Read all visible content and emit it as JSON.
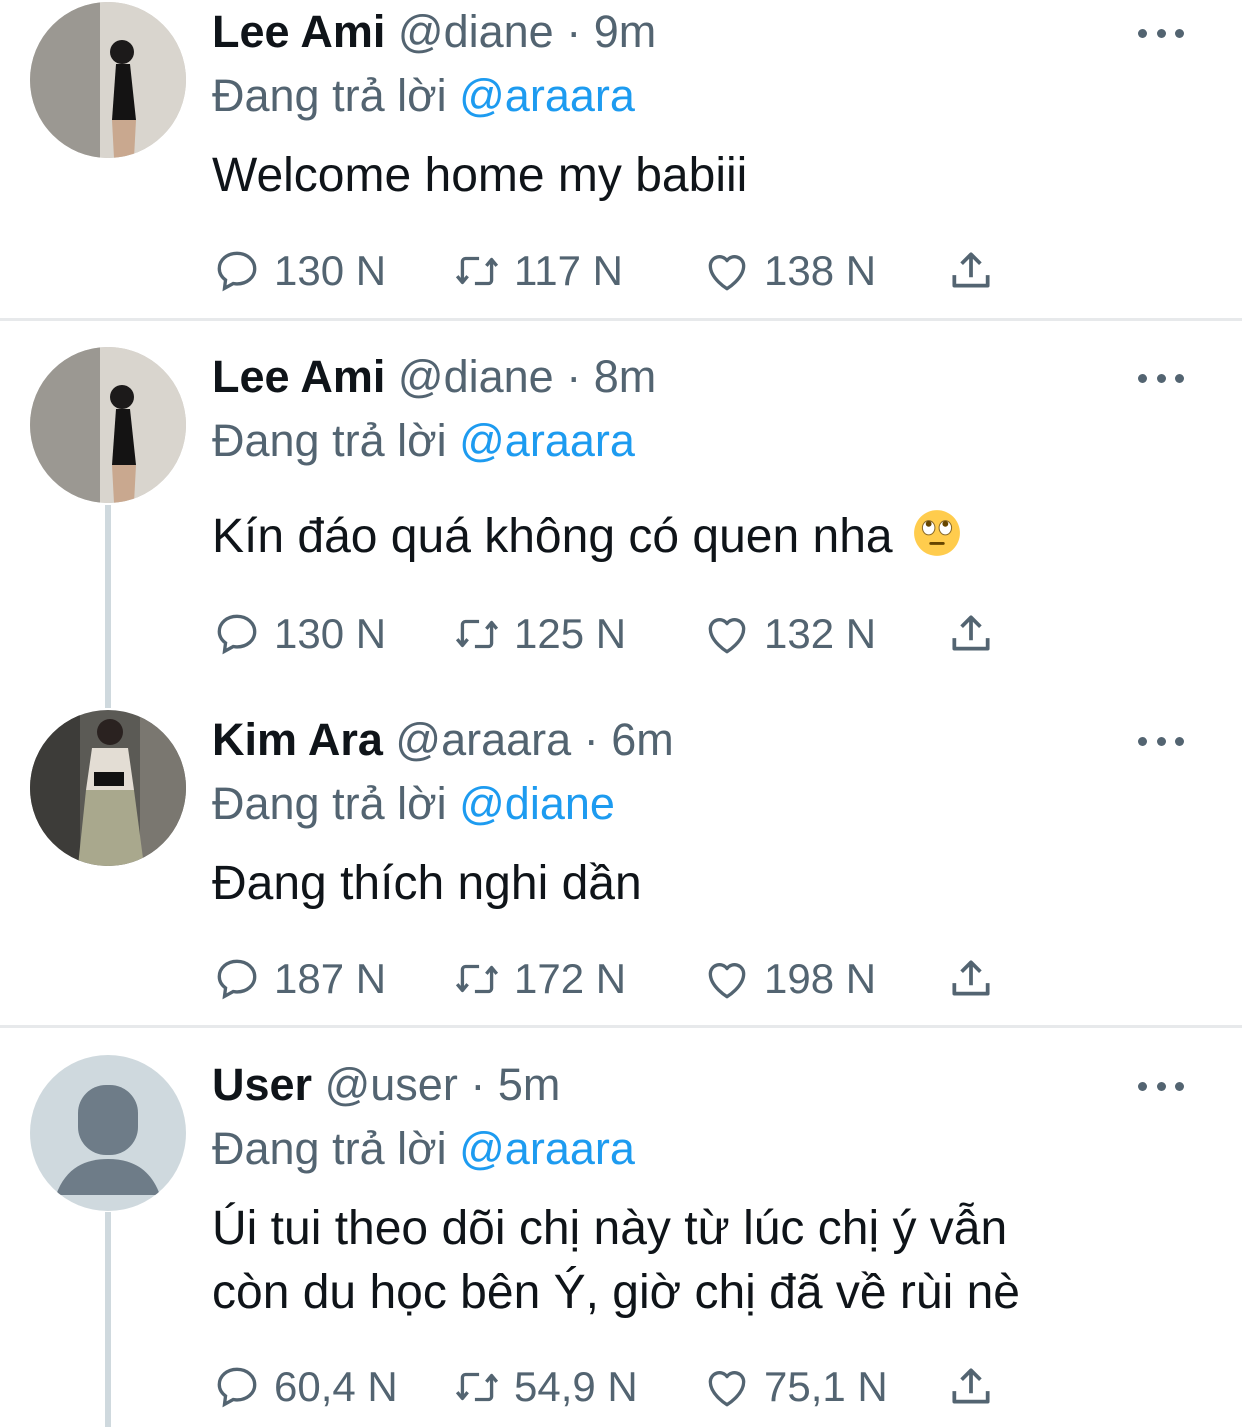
{
  "tweets": [
    {
      "name": "Lee Ami",
      "handle": "@diane",
      "time": "9m",
      "reply_prefix": "Đang trả lời",
      "reply_to": "@araara",
      "text": "Welcome home my babiii",
      "replies": "130 N",
      "retweets": "117 N",
      "likes": "138 N"
    },
    {
      "name": "Lee Ami",
      "handle": "@diane",
      "time": "8m",
      "reply_prefix": "Đang trả lời",
      "reply_to": "@araara",
      "text": "Kín đáo quá không có quen nha",
      "emoji": "face-with-rolling-eyes",
      "replies": "130 N",
      "retweets": "125 N",
      "likes": "132 N"
    },
    {
      "name": "Kim Ara",
      "handle": "@araara",
      "time": "6m",
      "reply_prefix": "Đang trả lời",
      "reply_to": "@diane",
      "text": "Đang thích nghi dần",
      "replies": "187 N",
      "retweets": "172 N",
      "likes": "198 N"
    },
    {
      "name": "User",
      "handle": "@user",
      "time": "5m",
      "reply_prefix": "Đang trả lời",
      "reply_to": "@araara",
      "text_line1": "Úi tui theo dõi chị này từ lúc chị ý vẫn",
      "text_line2": "còn du học bên Ý, giờ chị đã về rùi nè",
      "replies": "60,4 N",
      "retweets": "54,9 N",
      "likes": "75,1 N"
    }
  ],
  "separator": "·",
  "icons": {
    "reply": "reply-bubble-icon",
    "retweet": "retweet-icon",
    "like": "heart-icon",
    "share": "share-upload-icon",
    "more": "more-dots-icon"
  },
  "colors": {
    "mention": "#1d9bf0",
    "secondary": "#536471",
    "text": "#0f1419"
  }
}
